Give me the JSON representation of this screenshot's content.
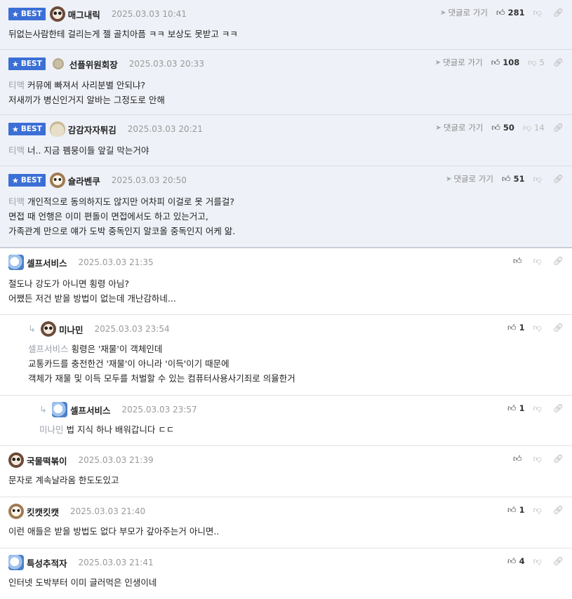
{
  "labels": {
    "best": "BEST",
    "goto": "댓글로 가기"
  },
  "comments": [
    {
      "best": true,
      "avatar": "panda",
      "nick": "매그내릭",
      "date": "2025.03.03 10:41",
      "goto": true,
      "likes": "281",
      "dislikes": "",
      "mention": "",
      "lines": [
        "뒤없는사람한테 걸리는게 젤 골치아픔 ㅋㅋ 보상도 못받고 ㅋㅋ"
      ]
    },
    {
      "best": true,
      "avatar": "gray",
      "nick": "선플위원회장",
      "date": "2025.03.03 20:33",
      "goto": true,
      "likes": "108",
      "dislikes": "5",
      "mention": "티맥",
      "lines": [
        "커뮤에 빠져서 사리분별 안되냐?",
        "저새끼가 병신인거지 알바는 그정도로 안해"
      ]
    },
    {
      "best": true,
      "avatar": "bun",
      "nick": "감감자자튀김",
      "date": "2025.03.03 20:21",
      "goto": true,
      "likes": "50",
      "dislikes": "14",
      "mention": "티맥",
      "lines": [
        "너.. 지금 폠뭉이들 앞길 막는거야"
      ]
    },
    {
      "best": true,
      "avatar": "dog",
      "nick": "슐라벤쿠",
      "date": "2025.03.03 20:50",
      "goto": true,
      "likes": "51",
      "dislikes": "",
      "mention": "티맥",
      "lines": [
        "개인적으로 동의하지도 않지만 어차피 이걸로 못 거를걸?",
        "면접 때 언행은 이미 편돌이 면접에서도 하고 있는거고,",
        "가족관계 만으로 얘가 도박 중독인지 알코올 중독인지 어케 앎."
      ]
    },
    {
      "best": false,
      "avatar": "ghost",
      "nick": "셀프서비스",
      "date": "2025.03.03 21:35",
      "goto": false,
      "likes": "",
      "dislikes": "",
      "mention": "",
      "lines": [
        "절도나 강도가 아니면 횡령 아님?",
        "어쨌든 저건 받을 방법이 없는데 개난감하네..."
      ]
    },
    {
      "best": false,
      "avatar": "panda",
      "nick": "미나민",
      "date": "2025.03.03 23:54",
      "goto": false,
      "likes": "1",
      "dislikes": "",
      "mention": "셀프서비스",
      "lines": [
        "횡령은 '재물'이 객체인데",
        "교통카드를 충전한건 '재물'이 아니라 '이득'이기 때문에",
        "객체가 재물 및 이득 모두를 처벌할 수 있는 컴퓨터사용사기죄로 의율한거"
      ]
    },
    {
      "best": false,
      "avatar": "ghost",
      "nick": "셀프서비스",
      "date": "2025.03.03 23:57",
      "goto": false,
      "likes": "1",
      "dislikes": "",
      "mention": "미나민",
      "lines": [
        "법 지식 하나 배워갑니다 ㄷㄷ"
      ]
    },
    {
      "best": false,
      "avatar": "panda",
      "nick": "국물떡볶이",
      "date": "2025.03.03 21:39",
      "goto": false,
      "likes": "",
      "dislikes": "",
      "mention": "",
      "lines": [
        "문자로 계속날라옴 한도도있고"
      ]
    },
    {
      "best": false,
      "avatar": "dog",
      "nick": "킷캣킷캣",
      "date": "2025.03.03 21:40",
      "goto": false,
      "likes": "1",
      "dislikes": "",
      "mention": "",
      "lines": [
        "이런 애들은 받을 방법도 없다 부모가 갚아주는거 아니면.."
      ]
    },
    {
      "best": false,
      "avatar": "ghost",
      "nick": "특성추적자",
      "date": "2025.03.03 21:41",
      "goto": false,
      "likes": "4",
      "dislikes": "",
      "mention": "",
      "lines": [
        "인터넷 도박부터 이미 글러먹은 인생이네"
      ]
    }
  ]
}
